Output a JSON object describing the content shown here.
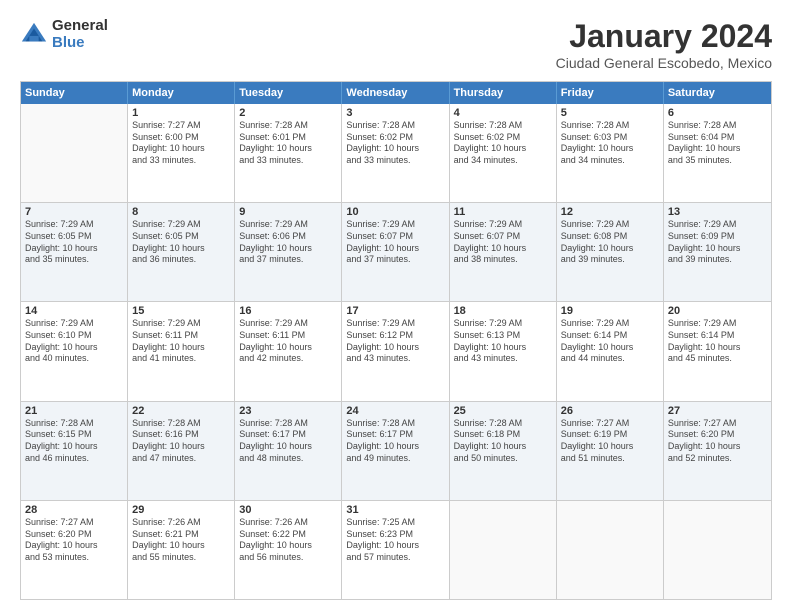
{
  "logo": {
    "general": "General",
    "blue": "Blue"
  },
  "title": "January 2024",
  "subtitle": "Ciudad General Escobedo, Mexico",
  "weekdays": [
    "Sunday",
    "Monday",
    "Tuesday",
    "Wednesday",
    "Thursday",
    "Friday",
    "Saturday"
  ],
  "rows": [
    [
      {
        "day": "",
        "info": ""
      },
      {
        "day": "1",
        "info": "Sunrise: 7:27 AM\nSunset: 6:00 PM\nDaylight: 10 hours\nand 33 minutes."
      },
      {
        "day": "2",
        "info": "Sunrise: 7:28 AM\nSunset: 6:01 PM\nDaylight: 10 hours\nand 33 minutes."
      },
      {
        "day": "3",
        "info": "Sunrise: 7:28 AM\nSunset: 6:02 PM\nDaylight: 10 hours\nand 33 minutes."
      },
      {
        "day": "4",
        "info": "Sunrise: 7:28 AM\nSunset: 6:02 PM\nDaylight: 10 hours\nand 34 minutes."
      },
      {
        "day": "5",
        "info": "Sunrise: 7:28 AM\nSunset: 6:03 PM\nDaylight: 10 hours\nand 34 minutes."
      },
      {
        "day": "6",
        "info": "Sunrise: 7:28 AM\nSunset: 6:04 PM\nDaylight: 10 hours\nand 35 minutes."
      }
    ],
    [
      {
        "day": "7",
        "info": "Sunrise: 7:29 AM\nSunset: 6:05 PM\nDaylight: 10 hours\nand 35 minutes."
      },
      {
        "day": "8",
        "info": "Sunrise: 7:29 AM\nSunset: 6:05 PM\nDaylight: 10 hours\nand 36 minutes."
      },
      {
        "day": "9",
        "info": "Sunrise: 7:29 AM\nSunset: 6:06 PM\nDaylight: 10 hours\nand 37 minutes."
      },
      {
        "day": "10",
        "info": "Sunrise: 7:29 AM\nSunset: 6:07 PM\nDaylight: 10 hours\nand 37 minutes."
      },
      {
        "day": "11",
        "info": "Sunrise: 7:29 AM\nSunset: 6:07 PM\nDaylight: 10 hours\nand 38 minutes."
      },
      {
        "day": "12",
        "info": "Sunrise: 7:29 AM\nSunset: 6:08 PM\nDaylight: 10 hours\nand 39 minutes."
      },
      {
        "day": "13",
        "info": "Sunrise: 7:29 AM\nSunset: 6:09 PM\nDaylight: 10 hours\nand 39 minutes."
      }
    ],
    [
      {
        "day": "14",
        "info": "Sunrise: 7:29 AM\nSunset: 6:10 PM\nDaylight: 10 hours\nand 40 minutes."
      },
      {
        "day": "15",
        "info": "Sunrise: 7:29 AM\nSunset: 6:11 PM\nDaylight: 10 hours\nand 41 minutes."
      },
      {
        "day": "16",
        "info": "Sunrise: 7:29 AM\nSunset: 6:11 PM\nDaylight: 10 hours\nand 42 minutes."
      },
      {
        "day": "17",
        "info": "Sunrise: 7:29 AM\nSunset: 6:12 PM\nDaylight: 10 hours\nand 43 minutes."
      },
      {
        "day": "18",
        "info": "Sunrise: 7:29 AM\nSunset: 6:13 PM\nDaylight: 10 hours\nand 43 minutes."
      },
      {
        "day": "19",
        "info": "Sunrise: 7:29 AM\nSunset: 6:14 PM\nDaylight: 10 hours\nand 44 minutes."
      },
      {
        "day": "20",
        "info": "Sunrise: 7:29 AM\nSunset: 6:14 PM\nDaylight: 10 hours\nand 45 minutes."
      }
    ],
    [
      {
        "day": "21",
        "info": "Sunrise: 7:28 AM\nSunset: 6:15 PM\nDaylight: 10 hours\nand 46 minutes."
      },
      {
        "day": "22",
        "info": "Sunrise: 7:28 AM\nSunset: 6:16 PM\nDaylight: 10 hours\nand 47 minutes."
      },
      {
        "day": "23",
        "info": "Sunrise: 7:28 AM\nSunset: 6:17 PM\nDaylight: 10 hours\nand 48 minutes."
      },
      {
        "day": "24",
        "info": "Sunrise: 7:28 AM\nSunset: 6:17 PM\nDaylight: 10 hours\nand 49 minutes."
      },
      {
        "day": "25",
        "info": "Sunrise: 7:28 AM\nSunset: 6:18 PM\nDaylight: 10 hours\nand 50 minutes."
      },
      {
        "day": "26",
        "info": "Sunrise: 7:27 AM\nSunset: 6:19 PM\nDaylight: 10 hours\nand 51 minutes."
      },
      {
        "day": "27",
        "info": "Sunrise: 7:27 AM\nSunset: 6:20 PM\nDaylight: 10 hours\nand 52 minutes."
      }
    ],
    [
      {
        "day": "28",
        "info": "Sunrise: 7:27 AM\nSunset: 6:20 PM\nDaylight: 10 hours\nand 53 minutes."
      },
      {
        "day": "29",
        "info": "Sunrise: 7:26 AM\nSunset: 6:21 PM\nDaylight: 10 hours\nand 55 minutes."
      },
      {
        "day": "30",
        "info": "Sunrise: 7:26 AM\nSunset: 6:22 PM\nDaylight: 10 hours\nand 56 minutes."
      },
      {
        "day": "31",
        "info": "Sunrise: 7:25 AM\nSunset: 6:23 PM\nDaylight: 10 hours\nand 57 minutes."
      },
      {
        "day": "",
        "info": ""
      },
      {
        "day": "",
        "info": ""
      },
      {
        "day": "",
        "info": ""
      }
    ]
  ]
}
